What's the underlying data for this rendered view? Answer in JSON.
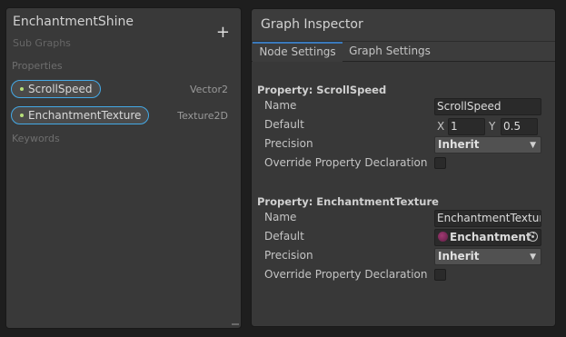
{
  "blackboard": {
    "title": "EnchantmentShine",
    "subtitle": "Sub Graphs",
    "add_label": "+",
    "properties_header": "Properties",
    "keywords_header": "Keywords",
    "properties": [
      {
        "name": "ScrollSpeed",
        "type": "Vector2"
      },
      {
        "name": "EnchantmentTexture",
        "type": "Texture2D"
      }
    ]
  },
  "inspector": {
    "title": "Graph Inspector",
    "tabs": [
      {
        "label": "Node Settings",
        "active": true
      },
      {
        "label": "Graph Settings",
        "active": false
      }
    ],
    "sections": [
      {
        "header": "Property: ScrollSpeed",
        "name_label": "Name",
        "name_value": "ScrollSpeed",
        "default_label": "Default",
        "default_x_label": "X",
        "default_x": "1",
        "default_y_label": "Y",
        "default_y": "0.5",
        "precision_label": "Precision",
        "precision_value": "Inherit",
        "override_label": "Override Property Declaration",
        "override_checked": false
      },
      {
        "header": "Property: EnchantmentTexture",
        "name_label": "Name",
        "name_value": "EnchantmentTextur",
        "default_label": "Default",
        "default_object": "Enchantment`",
        "precision_label": "Precision",
        "precision_value": "Inherit",
        "override_label": "Override Property Declaration",
        "override_checked": false
      }
    ]
  },
  "colors": {
    "accent": "#44a9e6",
    "tab_underline": "#3a79bb",
    "property_dot": "#b7e07a"
  }
}
